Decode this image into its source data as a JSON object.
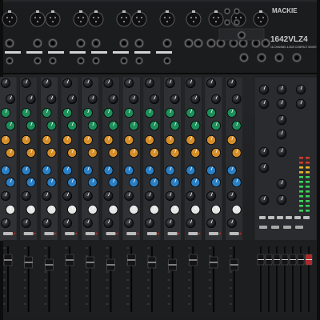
{
  "device": {
    "brand": "MACKIE",
    "model": "1642VLZ4",
    "subtitle": "16-CHANNEL 4-BUS COMPACT MIXER"
  },
  "layout": {
    "mono_channel_count": 8,
    "stereo_channel_count": 4,
    "master_fader_count": 7
  },
  "palette": {
    "chassis": "#2b2c2e",
    "panel_top": "#232427",
    "strip": "#2f3033",
    "knob_black": "#111214",
    "knob_green": "#1d8f5b",
    "knob_orange": "#d58f2a",
    "knob_blue": "#2a7fc4",
    "knob_white": "#e6e6e6",
    "meter_green": "#3ad25a",
    "meter_red": "#d23a2a"
  }
}
